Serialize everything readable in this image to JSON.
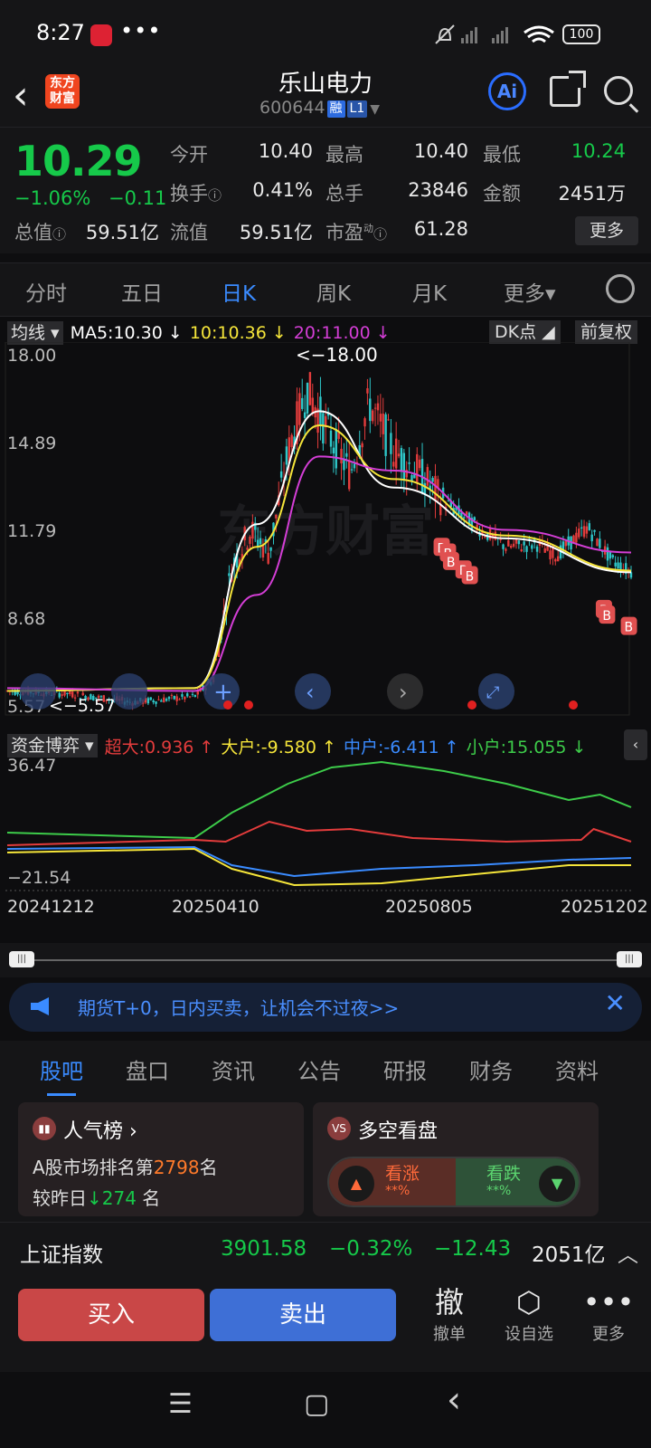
{
  "status": {
    "time": "8:27",
    "dots": "•••",
    "battery": "100"
  },
  "header": {
    "app_logo": "东方\n财富",
    "name": "乐山电力",
    "code": "600644",
    "badge1": "融",
    "badge2": "L1",
    "ai": "Ai"
  },
  "quote": {
    "price": "10.29",
    "pct": "−1.06%",
    "chg": "−0.11",
    "open_lbl": "今开",
    "open": "10.40",
    "high_lbl": "最高",
    "high": "10.40",
    "low_lbl": "最低",
    "low": "10.24",
    "turnover_lbl": "换手",
    "turnover": "0.41%",
    "vol_lbl": "总手",
    "vol": "23846",
    "amt_lbl": "金额",
    "amt": "2451万",
    "mcap_lbl": "总值",
    "mcap": "59.51亿",
    "fmcap_lbl": "流值",
    "fmcap": "59.51亿",
    "pe_lbl": "市盈",
    "pe_sup": "动",
    "pe": "61.28",
    "more": "更多"
  },
  "tabs": [
    "分时",
    "五日",
    "日K",
    "周K",
    "月K",
    "更多▾"
  ],
  "ma": {
    "chip": "均线 ▾",
    "ma5": "MA5:10.30 ↓",
    "ma10": "10:10.36 ↓",
    "ma20": "20:11.00 ↓",
    "dk": "DK点 ◢",
    "fq": "前复权",
    "colors": {
      "ma5": "#ffffff",
      "ma10": "#f5e53a",
      "ma20": "#d43ed6"
    }
  },
  "kchart": {
    "yticks": [
      "18.00",
      "14.89",
      "11.79",
      "8.68",
      "5.57"
    ],
    "max_label": "<−18.00",
    "min_label": "<−5.57",
    "watermark": "东方财富",
    "b_marker": "B"
  },
  "flow": {
    "chip": "资金博弈 ▾",
    "super": "超大:0.936 ↑",
    "big": "大户:-9.580 ↑",
    "mid": "中户:-6.411 ↑",
    "small": "小户:15.055 ↓",
    "ytop": "36.47",
    "ybot": "−21.54",
    "dates": [
      "20241212",
      "20250410",
      "20250805",
      "20251202"
    ],
    "btn": "‹"
  },
  "chart_data": {
    "type": "line",
    "title": "",
    "x": [
      "20241212",
      "20250410",
      "20250805",
      "20251202"
    ],
    "ylim": [
      5.57,
      18.0
    ],
    "y_ticks": [
      18.0,
      14.89,
      11.79,
      8.68,
      5.57
    ],
    "series": [
      {
        "name": "MA5",
        "values": [
          6.1,
          6.2,
          12.0,
          16.0,
          13.3,
          11.5,
          10.3
        ]
      },
      {
        "name": "10",
        "values": [
          6.1,
          6.2,
          11.2,
          15.5,
          13.6,
          11.6,
          10.36
        ]
      },
      {
        "name": "20",
        "values": [
          6.2,
          6.1,
          9.5,
          14.4,
          13.9,
          11.8,
          11.0
        ]
      }
    ]
  },
  "banner": {
    "text": "期货T+0，日内买卖，让机会不过夜>>",
    "close": "✕"
  },
  "news_tabs": [
    "股吧",
    "盘口",
    "资讯",
    "公告",
    "研报",
    "财务",
    "资料"
  ],
  "rank": {
    "title": "人气榜 ›",
    "line1_a": "A股市场排名第",
    "line1_b": "2798",
    "line1_c": "名",
    "line2_a": "较昨日",
    "line2_b": "↓274",
    "line2_c": " 名"
  },
  "vs": {
    "title": "多空看盘",
    "up": "看涨",
    "up_sub": "**%",
    "down": "看跌",
    "down_sub": "**%"
  },
  "index": {
    "name": "上证指数",
    "value": "3901.58",
    "pct": "−0.32%",
    "chg": "−12.43",
    "amount": "2051亿",
    "arrow": "︿"
  },
  "trade": {
    "buy": "买入",
    "sell": "卖出",
    "cancel": "撤",
    "cancel_lbl": "撤单",
    "watch_lbl": "设自选",
    "more_lbl": "更多"
  },
  "nav": {
    "menu": "☰",
    "home": "▢",
    "back": "‹"
  }
}
